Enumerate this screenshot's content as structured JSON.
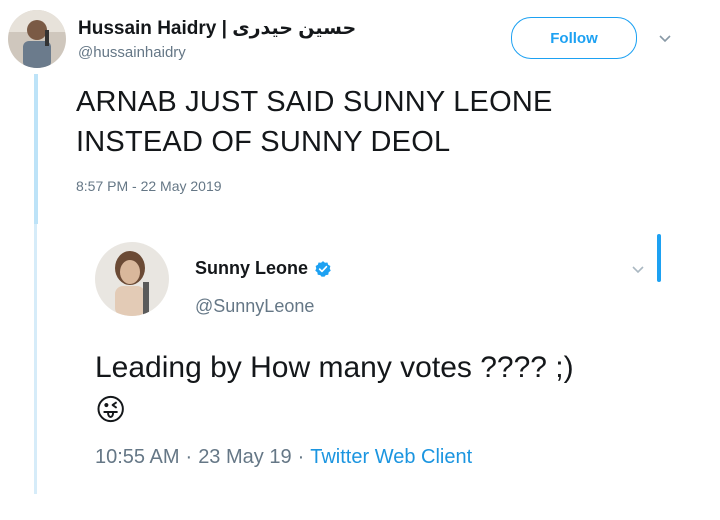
{
  "tweet": {
    "author_name": "Hussain Haidry | حسین حیدری",
    "author_handle": "@hussainhaidry",
    "follow_label": "Follow",
    "text_line1": "ARNAB JUST SAID SUNNY LEONE",
    "text_line2": "INSTEAD OF SUNNY DEOL",
    "timestamp": "8:57 PM - 22 May 2019"
  },
  "quoted": {
    "author_name": "Sunny Leone",
    "author_handle": "@SunnyLeone",
    "text": "Leading by How many votes ???? ;)",
    "emoji": "😜",
    "time": "10:55 AM",
    "date": "23 May 19",
    "separator": "·",
    "client": "Twitter Web Client"
  },
  "icons": {
    "chevron": "chevron-down-icon",
    "verified": "verified-badge-icon"
  },
  "colors": {
    "accent": "#1da1f2",
    "thread_line": "#bde3f8",
    "muted": "#657786"
  }
}
